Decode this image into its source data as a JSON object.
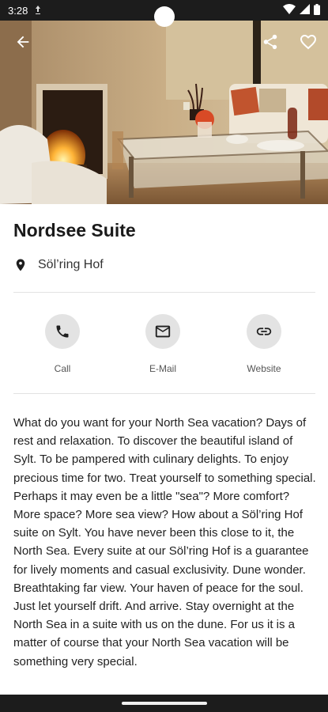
{
  "status_bar": {
    "time": "3:28",
    "icons": [
      "notification-icon",
      "wifi-icon",
      "signal-icon",
      "battery-icon"
    ]
  },
  "hero": {
    "image_description": "hotel suite living room with fireplace",
    "back_icon": "arrow-back-icon",
    "share_icon": "share-icon",
    "favorite_icon": "heart-outline-icon"
  },
  "listing": {
    "title": "Nordsee Suite",
    "location": "Söl’ring Hof"
  },
  "actions": [
    {
      "label": "Call",
      "icon": "phone-icon"
    },
    {
      "label": "E-Mail",
      "icon": "mail-icon"
    },
    {
      "label": "Website",
      "icon": "link-icon"
    }
  ],
  "description": {
    "paragraph1": "What do you want for your North Sea vacation? Days of rest and relaxation. To discover the beautiful island of Sylt. To be pampered with culinary delights. To enjoy precious time for two. Treat yourself to something special.",
    "paragraph2": "Perhaps it may even be a little \"sea\"? More comfort? More space? More sea view? How about a Söl’ring Hof suite on Sylt. You have never been this close to it, the North Sea. Every suite at our Söl’ring Hof is a guarantee for lively moments and casual exclusivity. Dune wonder. Breathtaking far view. Your haven of peace for the soul. Just let yourself drift. And arrive. Stay overnight at the North Sea in a suite with us on the dune. For us it is a matter of course that your North Sea vacation will be something very special."
  },
  "colors": {
    "status_bar": "#1c1c1c",
    "action_circle": "#e3e3e3",
    "divider": "#e2e2e2"
  }
}
